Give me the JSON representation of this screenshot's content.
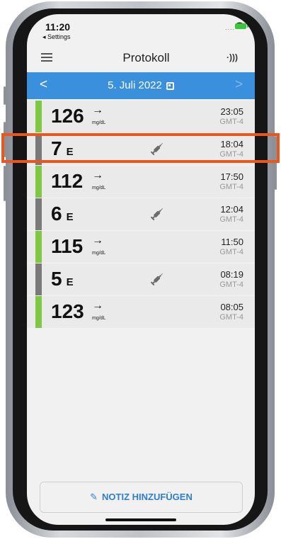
{
  "status": {
    "time": "11:20",
    "back_app": "◂ Settings",
    "signal": "....",
    "icons": [
      "wifi-icon",
      "battery-charging-icon"
    ]
  },
  "nav": {
    "title": "Protokoll",
    "menu_icon": "hamburger-icon",
    "nfc_icon": "nfc-icon"
  },
  "datebar": {
    "date": "5. Juli 2022",
    "prev": "<",
    "next": ">"
  },
  "entries": [
    {
      "type": "glucose",
      "value": "126",
      "unit": "mg/dL",
      "trend": "→",
      "time": "23:05",
      "tz": "GMT-4"
    },
    {
      "type": "insulin",
      "value": "7",
      "unit": "E",
      "time": "18:04",
      "tz": "GMT-4"
    },
    {
      "type": "glucose",
      "value": "112",
      "unit": "mg/dL",
      "trend": "→",
      "time": "17:50",
      "tz": "GMT-4"
    },
    {
      "type": "insulin",
      "value": "6",
      "unit": "E",
      "time": "12:04",
      "tz": "GMT-4"
    },
    {
      "type": "glucose",
      "value": "115",
      "unit": "mg/dL",
      "trend": "→",
      "time": "11:50",
      "tz": "GMT-4"
    },
    {
      "type": "insulin",
      "value": "5",
      "unit": "E",
      "time": "08:19",
      "tz": "GMT-4"
    },
    {
      "type": "glucose",
      "value": "123",
      "unit": "mg/dL",
      "trend": "→",
      "time": "08:05",
      "tz": "GMT-4"
    }
  ],
  "add_note": {
    "label": "NOTIZ HINZUFÜGEN",
    "icon": "pencil-icon"
  },
  "colors": {
    "accent": "#3a90dc",
    "glucose_bar": "#7fc843",
    "insulin_bar": "#7a7a7a",
    "highlight": "#e8571f"
  }
}
